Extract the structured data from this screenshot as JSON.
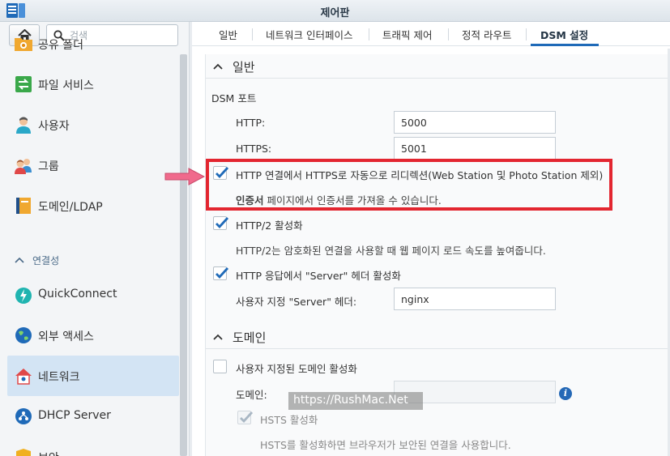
{
  "window": {
    "title": "제어판"
  },
  "sidebar": {
    "search_placeholder": "검색",
    "items": [
      {
        "label": "공유 폴더",
        "icon": "shared-folder-icon"
      },
      {
        "label": "파일 서비스",
        "icon": "file-services-icon"
      },
      {
        "label": "사용자",
        "icon": "user-icon"
      },
      {
        "label": "그룹",
        "icon": "group-icon"
      },
      {
        "label": "도메인/LDAP",
        "icon": "domain-ldap-icon"
      },
      {
        "label": "QuickConnect",
        "icon": "quickconnect-icon"
      },
      {
        "label": "외부 액세스",
        "icon": "external-access-icon"
      },
      {
        "label": "네트워크",
        "icon": "network-icon"
      },
      {
        "label": "DHCP Server",
        "icon": "dhcp-server-icon"
      },
      {
        "label": "보안",
        "icon": "security-icon"
      }
    ],
    "group_connectivity": "연결성",
    "active": "네트워크"
  },
  "tabs": [
    "일반",
    "네트워크 인터페이스",
    "트래픽 제어",
    "정적 라우트",
    "DSM 설정"
  ],
  "active_tab": "DSM 설정",
  "general": {
    "title": "일반",
    "dsm_port_label": "DSM 포트",
    "http_label": "HTTP:",
    "http_value": "5000",
    "https_label": "HTTPS:",
    "https_value": "5001",
    "redirect_label": "HTTP 연결에서 HTTPS로 자동으로 리디렉션(Web Station 및 Photo Station 제외)",
    "cert_link": "인증서",
    "cert_desc": " 페이지에서 인증서를 가져올 수 있습니다.",
    "http2_label": "HTTP/2 활성화",
    "http2_desc": "HTTP/2는 암호화된 연결을 사용할 때 웹 페이지 로드 속도를 높여줍니다.",
    "server_header_label": "HTTP 응답에서 \"Server\" 헤더 활성화",
    "custom_server_label": "사용자 지정 \"Server\" 헤더:",
    "custom_server_value": "nginx"
  },
  "domain": {
    "title": "도메인",
    "custom_domain_label": "사용자 지정된 도메인 활성화",
    "domain_label": "도메인:",
    "domain_value": "",
    "hsts_label": "HSTS 활성화",
    "hsts_desc": "HSTS를 활성화하면 브라우저가 보안된 연결을 사용합니다."
  },
  "watermark": "https://RushMac.Net",
  "colors": {
    "accent": "#1f6ab8",
    "highlight": "#e32630",
    "arrow": "#f06a8c"
  }
}
